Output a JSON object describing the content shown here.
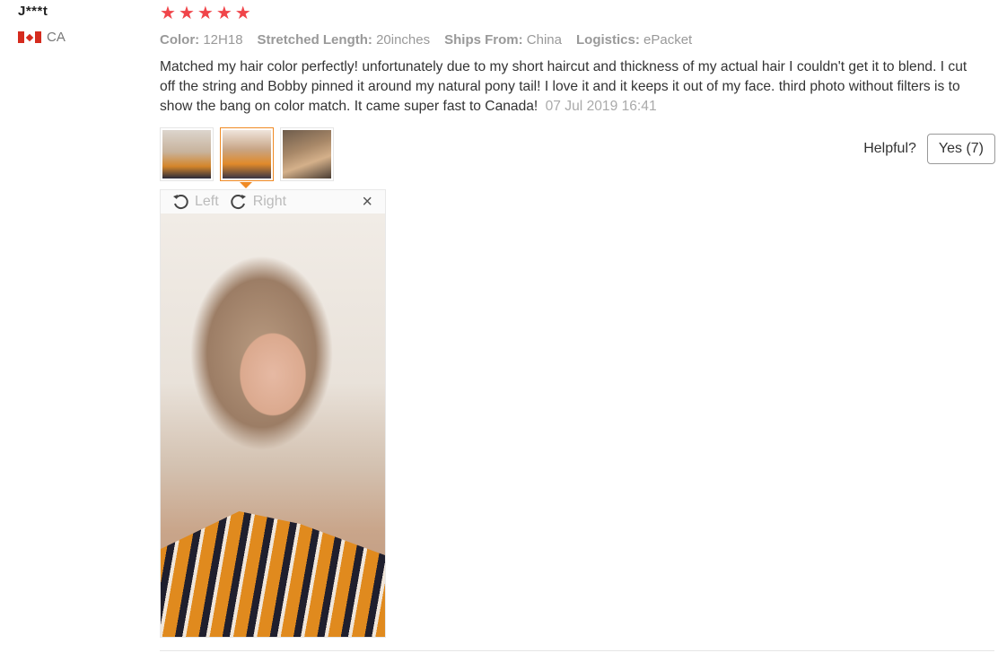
{
  "user": {
    "name": "J***t",
    "country": "CA"
  },
  "rating": {
    "stars": 5
  },
  "attributes": [
    {
      "label": "Color:",
      "value": "12H18"
    },
    {
      "label": "Stretched Length:",
      "value": "20inches"
    },
    {
      "label": "Ships From:",
      "value": "China"
    },
    {
      "label": "Logistics:",
      "value": "ePacket"
    }
  ],
  "review": {
    "text": "Matched my hair color perfectly! unfortunately due to my short haircut and thickness of my actual hair I couldn't get it to blend. I cut off the string and Bobby pinned it around my natural pony tail! I love it and it keeps it out of my face. third photo without filters is to show the bang on color match. It came super fast to Canada!",
    "date": "07 Jul 2019 16:41"
  },
  "viewer": {
    "left_label": "Left",
    "right_label": "Right",
    "close_label": "×"
  },
  "helpful": {
    "label": "Helpful?",
    "yes_label": "Yes (7)"
  },
  "colors": {
    "star": "#f0454a",
    "active_border": "#f08a24"
  }
}
